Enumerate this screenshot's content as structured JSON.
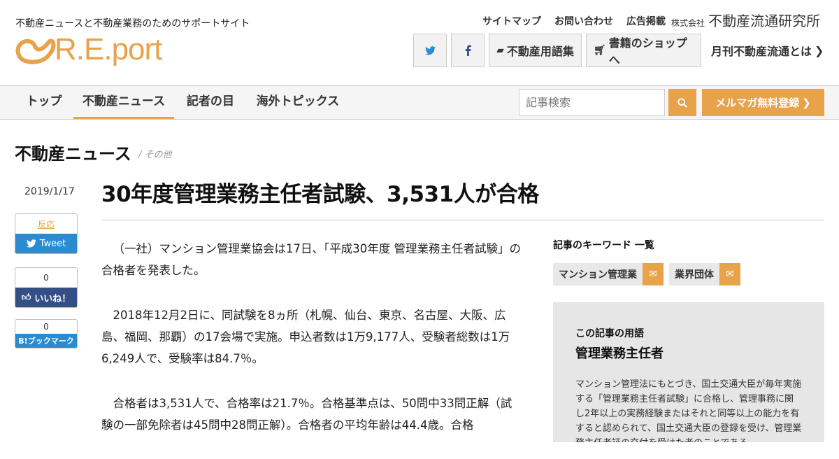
{
  "header": {
    "tagline": "不動産ニュースと不動産業務のためのサポートサイト",
    "logo_text": "R.E.port",
    "top_links": [
      "サイトマップ",
      "お問い合わせ",
      "広告掲載"
    ],
    "corp_small": "株式会社",
    "corp_name": "不動産流通研究所",
    "buttons": {
      "glossary": "不動産用語集",
      "bookshop": "書籍のショップへ",
      "monthly": "月刊不動産流通とは"
    }
  },
  "nav": {
    "items": [
      "トップ",
      "不動産ニュース",
      "記者の目",
      "海外トピックス"
    ],
    "search_placeholder": "記事検索",
    "mailmag": "メルマガ無料登録"
  },
  "section": {
    "title": "不動産ニュース",
    "sub": "/ その他"
  },
  "article": {
    "date": "2019/1/17",
    "title": "30年度管理業務主任者試験、3,531人が合格",
    "paragraphs": [
      "（一社）マンション管理業協会は17日、「平成30年度 管理業務主任者試験」の合格者を発表した。",
      "2018年12月2日に、同試験を8ヵ所（札幌、仙台、東京、名古屋、大阪、広島、福岡、那覇）の17会場で実施。申込者数は1万9,177人、受験者総数は1万6,249人で、受験率は84.7％。",
      "合格者は3,531人で、合格率は21.7％。合格基準点は、50問中33問正解（試験の一部免除者は45問中28問正解）。合格者の平均年齢は44.4歳。合格"
    ]
  },
  "share": {
    "tw_count": "反応",
    "tw_label": "Tweet",
    "fb_count": "0",
    "fb_label": "いいね！",
    "hb_count": "0",
    "hb_label": "B!ブックマーク"
  },
  "keywords": {
    "heading": "記事のキーワード 一覧",
    "items": [
      "マンション管理業",
      "業界団体"
    ]
  },
  "term": {
    "label": "この記事の用語",
    "title": "管理業務主任者",
    "desc": "マンション管理法にもとづき、国土交通大臣が毎年実施する「管理業務主任者試験」に合格し、管理事務に関し2年以上の実務経験またはそれと同等以上の能力を有すると認められて、国土交通大臣の登録を受け、管理業務主任者証の交付を受けた者のことである。"
  },
  "colors": {
    "accent": "#e8a24a",
    "twitter": "#2a8bd0",
    "facebook": "#344e86"
  }
}
